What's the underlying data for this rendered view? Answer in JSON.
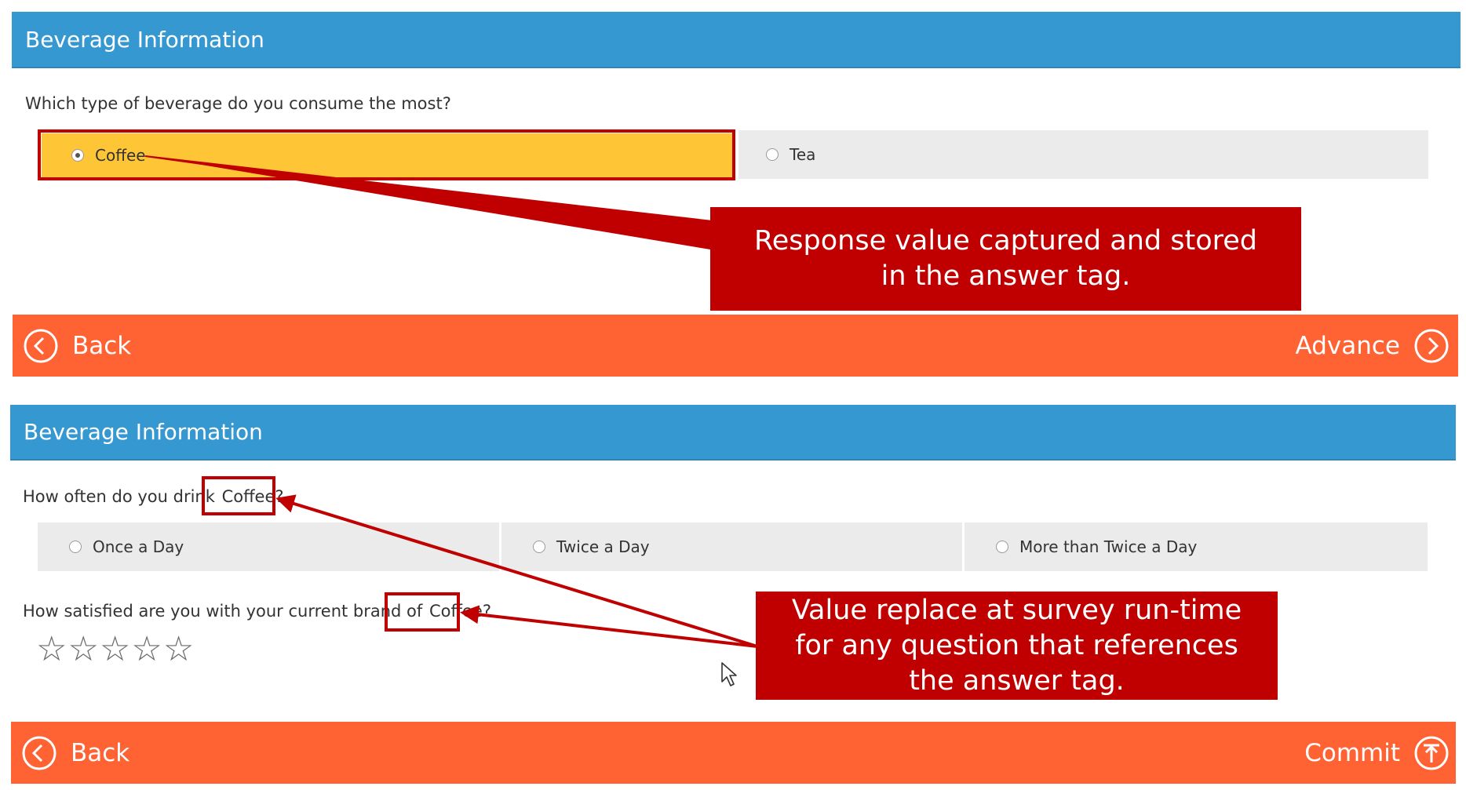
{
  "section1": {
    "header_title": "Beverage Information",
    "question": "Which type of beverage do you consume the most?",
    "options": [
      {
        "label": "Coffee",
        "selected": true
      },
      {
        "label": "Tea",
        "selected": false
      }
    ],
    "nav": {
      "back_label": "Back",
      "advance_label": "Advance"
    }
  },
  "callout_top": "Response value captured and stored in the answer tag.",
  "section2": {
    "header_title": "Beverage Information",
    "question1_prefix": "How often do you drink",
    "question1_tag": "Coffee?",
    "frequency_options": [
      {
        "label": "Once a Day",
        "selected": false
      },
      {
        "label": "Twice a Day",
        "selected": false
      },
      {
        "label": "More than Twice a Day",
        "selected": false
      }
    ],
    "question2_prefix": "How satisfied are you with your current brand of",
    "question2_tag": "Coffee?",
    "rating": {
      "max": 5,
      "value": 0
    },
    "nav": {
      "back_label": "Back",
      "commit_label": "Commit"
    }
  },
  "callout_bottom": "Value replace at survey run-time for any question that references the answer tag.",
  "colors": {
    "header": "#3598d1",
    "nav": "#ff6233",
    "selected_option": "#fec536",
    "option": "#ebebeb",
    "callout": "#c00000"
  },
  "icons": [
    "chevron-left-circle-icon",
    "chevron-right-circle-icon",
    "arrow-up-circle-icon",
    "star-outline-icon",
    "radio-icon",
    "cursor-icon"
  ]
}
